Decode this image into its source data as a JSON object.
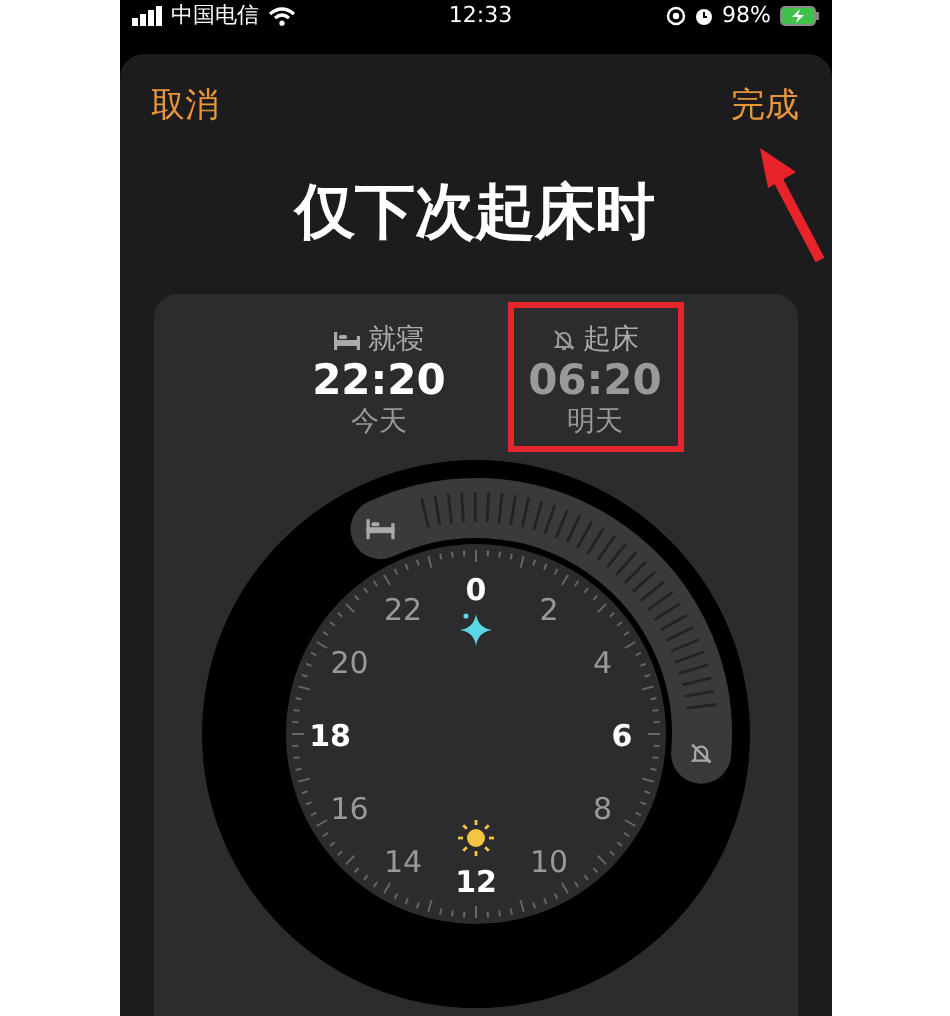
{
  "status_bar": {
    "carrier": "中国电信",
    "time": "12:33",
    "battery": "98%"
  },
  "header": {
    "cancel": "取消",
    "done": "完成"
  },
  "title": "仅下次起床时",
  "bedtime": {
    "label": "就寝",
    "time": "22:20",
    "day": "今天"
  },
  "wakeup": {
    "label": "起床",
    "time": "06:20",
    "day": "明天",
    "alarm": false
  },
  "clock": {
    "hours": [
      "0",
      "2",
      "4",
      "6",
      "8",
      "10",
      "12",
      "14",
      "16",
      "18",
      "20",
      "22"
    ]
  }
}
